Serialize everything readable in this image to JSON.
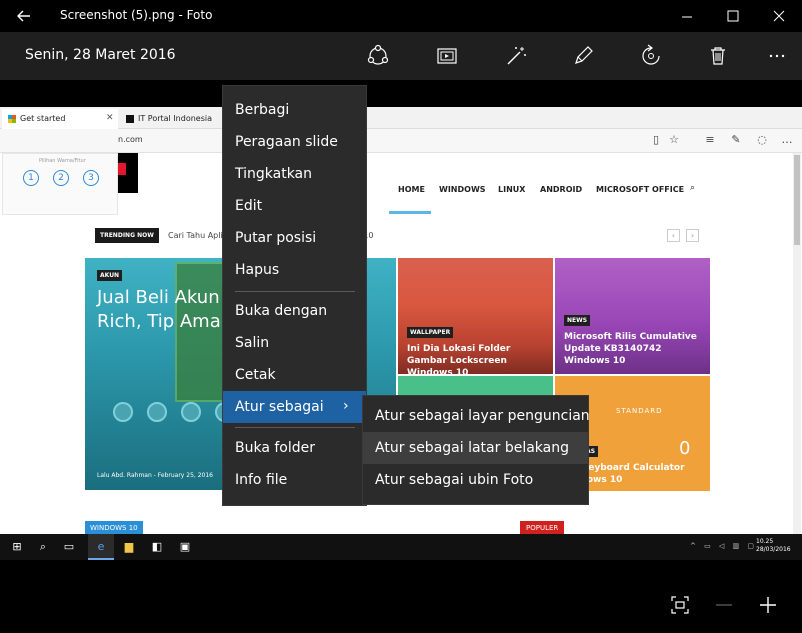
{
  "window": {
    "title": "Screenshot (5).png - Foto",
    "back_icon": "arrow-left-icon",
    "min_icon": "minimize-icon",
    "max_icon": "maximize-icon",
    "close_icon": "close-icon"
  },
  "toolbar": {
    "date": "Senin, 28 Maret 2016",
    "tools": [
      "share-icon",
      "slideshow-icon",
      "enhance-icon",
      "edit-icon",
      "rotate-icon",
      "delete-icon",
      "more-icon"
    ]
  },
  "context_menu": {
    "items": [
      {
        "label": "Berbagi"
      },
      {
        "label": "Peragaan slide"
      },
      {
        "label": "Tingkatkan"
      },
      {
        "label": "Edit"
      },
      {
        "label": "Putar posisi"
      },
      {
        "label": "Hapus"
      },
      {
        "label": "Buka dengan"
      },
      {
        "label": "Salin"
      },
      {
        "label": "Cetak"
      },
      {
        "label": "Atur sebagai"
      },
      {
        "label": "Buka folder"
      },
      {
        "label": "Info file"
      }
    ],
    "submenu_arrow": "›"
  },
  "submenu": {
    "items": [
      {
        "label": "Atur sebagai layar penguncian"
      },
      {
        "label": "Atur sebagai latar belakang"
      },
      {
        "label": "Atur sebagai ubin Foto"
      }
    ]
  },
  "photo": {
    "browser_tabs": [
      {
        "label": "Get started",
        "close": "✕"
      },
      {
        "label": "IT Portal Indonesia"
      }
    ],
    "address_fragment": "n.com",
    "preview_title": "Pilihan Warna/Fitur",
    "preview_steps": [
      "1",
      "2",
      "3"
    ],
    "nav": [
      "HOME",
      "WINDOWS",
      "LINUX",
      "ANDROID",
      "MICROSOFT OFFICE"
    ],
    "trending_badge": "TRENDING NOW",
    "trending_text": "Cari Tahu Apli",
    "trending_text_end": "ws 10",
    "pager": [
      "‹",
      "›"
    ],
    "tiles": {
      "big_badge": "AKUN",
      "big_title_line1": "Jual Beli Akun",
      "big_title_line2": "Rich, Tip Aman",
      "big_byline": "Lalu Abd. Rahman - February 25, 2016",
      "red_badge": "WALLPAPER",
      "red_title": "Ini Dia Lokasi Folder Gambar Lockscreen Windows 10",
      "purple_badge": "NEWS",
      "purple_title": "Microsoft Rilis Cumulative Update KB3140742 Windows 10",
      "orange_label": "STANDARD",
      "orange_value": "0",
      "orange_badge": "AKTIVITAS",
      "orange_title": "Cut Keyboard Calculator Windows 10"
    },
    "section_left": "WINDOWS 10",
    "section_right": "POPULER",
    "taskbar_time": "10.25",
    "taskbar_date": "28/03/2016"
  },
  "zoom": {
    "fit_icon": "fit-screen-icon",
    "zoom_out_icon": "zoom-out-icon",
    "zoom_in_icon": "zoom-in-icon"
  }
}
